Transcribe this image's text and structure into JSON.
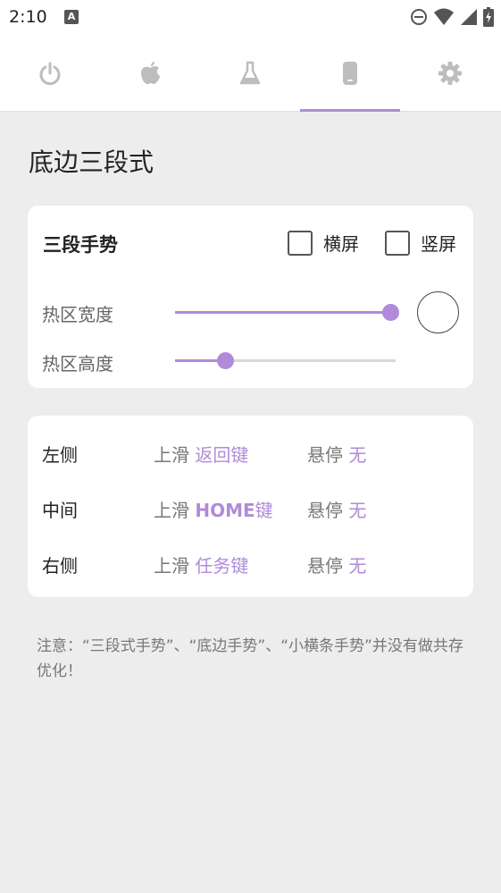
{
  "status_bar": {
    "time": "2:10",
    "notification_icon": "A",
    "icons": [
      "dnd-icon",
      "wifi-icon",
      "cell-signal-icon",
      "battery-icon"
    ]
  },
  "tabs": [
    {
      "icon": "power-icon",
      "active": false
    },
    {
      "icon": "apple-icon",
      "active": false
    },
    {
      "icon": "flask-icon",
      "active": false
    },
    {
      "icon": "phone-icon",
      "active": true
    },
    {
      "icon": "gear-icon",
      "active": false
    }
  ],
  "page_title": "底边三段式",
  "gesture_card": {
    "title": "三段手势",
    "landscape_label": "横屏",
    "portrait_label": "竖屏",
    "landscape_checked": false,
    "portrait_checked": false,
    "width_label": "热区宽度",
    "height_label": "热区高度",
    "width_value": 1.0,
    "height_value": 0.22
  },
  "actions_card": {
    "rows": [
      {
        "side": "左侧",
        "swipe_label": "上滑",
        "swipe_value": "返回键",
        "hover_label": "悬停",
        "hover_value": "无"
      },
      {
        "side": "中间",
        "swipe_label": "上滑",
        "swipe_value_bold": "HOME",
        "swipe_value": "键",
        "hover_label": "悬停",
        "hover_value": "无"
      },
      {
        "side": "右侧",
        "swipe_label": "上滑",
        "swipe_value": "任务键",
        "hover_label": "悬停",
        "hover_value": "无"
      }
    ]
  },
  "note": "注意：“三段式手势”、“底边手势”、“小横条手势”并没有做共存优化！",
  "colors": {
    "accent": "#b08bd9",
    "background": "#ededed",
    "card": "#ffffff"
  }
}
